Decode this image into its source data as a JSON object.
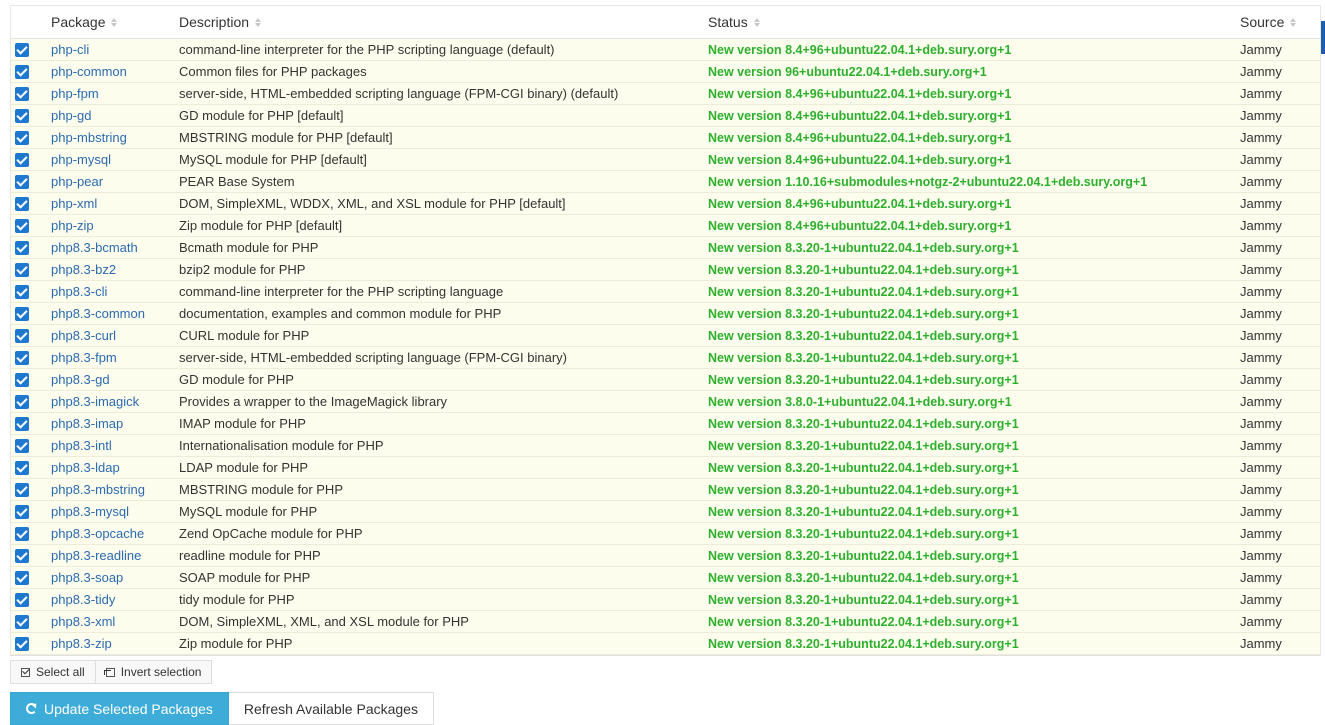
{
  "table": {
    "headers": {
      "package": "Package",
      "description": "Description",
      "status": "Status",
      "source": "Source"
    },
    "rows": [
      {
        "package": "php-cli",
        "description": "command-line interpreter for the PHP scripting language (default)",
        "status": "New version 8.4+96+ubuntu22.04.1+deb.sury.org+1",
        "source": "Jammy"
      },
      {
        "package": "php-common",
        "description": "Common files for PHP packages",
        "status": "New version 96+ubuntu22.04.1+deb.sury.org+1",
        "source": "Jammy"
      },
      {
        "package": "php-fpm",
        "description": "server-side, HTML-embedded scripting language (FPM-CGI binary) (default)",
        "status": "New version 8.4+96+ubuntu22.04.1+deb.sury.org+1",
        "source": "Jammy"
      },
      {
        "package": "php-gd",
        "description": "GD module for PHP [default]",
        "status": "New version 8.4+96+ubuntu22.04.1+deb.sury.org+1",
        "source": "Jammy"
      },
      {
        "package": "php-mbstring",
        "description": "MBSTRING module for PHP [default]",
        "status": "New version 8.4+96+ubuntu22.04.1+deb.sury.org+1",
        "source": "Jammy"
      },
      {
        "package": "php-mysql",
        "description": "MySQL module for PHP [default]",
        "status": "New version 8.4+96+ubuntu22.04.1+deb.sury.org+1",
        "source": "Jammy"
      },
      {
        "package": "php-pear",
        "description": "PEAR Base System",
        "status": "New version 1.10.16+submodules+notgz-2+ubuntu22.04.1+deb.sury.org+1",
        "source": "Jammy"
      },
      {
        "package": "php-xml",
        "description": "DOM, SimpleXML, WDDX, XML, and XSL module for PHP [default]",
        "status": "New version 8.4+96+ubuntu22.04.1+deb.sury.org+1",
        "source": "Jammy"
      },
      {
        "package": "php-zip",
        "description": "Zip module for PHP [default]",
        "status": "New version 8.4+96+ubuntu22.04.1+deb.sury.org+1",
        "source": "Jammy"
      },
      {
        "package": "php8.3-bcmath",
        "description": "Bcmath module for PHP",
        "status": "New version 8.3.20-1+ubuntu22.04.1+deb.sury.org+1",
        "source": "Jammy"
      },
      {
        "package": "php8.3-bz2",
        "description": "bzip2 module for PHP",
        "status": "New version 8.3.20-1+ubuntu22.04.1+deb.sury.org+1",
        "source": "Jammy"
      },
      {
        "package": "php8.3-cli",
        "description": "command-line interpreter for the PHP scripting language",
        "status": "New version 8.3.20-1+ubuntu22.04.1+deb.sury.org+1",
        "source": "Jammy"
      },
      {
        "package": "php8.3-common",
        "description": "documentation, examples and common module for PHP",
        "status": "New version 8.3.20-1+ubuntu22.04.1+deb.sury.org+1",
        "source": "Jammy"
      },
      {
        "package": "php8.3-curl",
        "description": "CURL module for PHP",
        "status": "New version 8.3.20-1+ubuntu22.04.1+deb.sury.org+1",
        "source": "Jammy"
      },
      {
        "package": "php8.3-fpm",
        "description": "server-side, HTML-embedded scripting language (FPM-CGI binary)",
        "status": "New version 8.3.20-1+ubuntu22.04.1+deb.sury.org+1",
        "source": "Jammy"
      },
      {
        "package": "php8.3-gd",
        "description": "GD module for PHP",
        "status": "New version 8.3.20-1+ubuntu22.04.1+deb.sury.org+1",
        "source": "Jammy"
      },
      {
        "package": "php8.3-imagick",
        "description": "Provides a wrapper to the ImageMagick library",
        "status": "New version 3.8.0-1+ubuntu22.04.1+deb.sury.org+1",
        "source": "Jammy"
      },
      {
        "package": "php8.3-imap",
        "description": "IMAP module for PHP",
        "status": "New version 8.3.20-1+ubuntu22.04.1+deb.sury.org+1",
        "source": "Jammy"
      },
      {
        "package": "php8.3-intl",
        "description": "Internationalisation module for PHP",
        "status": "New version 8.3.20-1+ubuntu22.04.1+deb.sury.org+1",
        "source": "Jammy"
      },
      {
        "package": "php8.3-ldap",
        "description": "LDAP module for PHP",
        "status": "New version 8.3.20-1+ubuntu22.04.1+deb.sury.org+1",
        "source": "Jammy"
      },
      {
        "package": "php8.3-mbstring",
        "description": "MBSTRING module for PHP",
        "status": "New version 8.3.20-1+ubuntu22.04.1+deb.sury.org+1",
        "source": "Jammy"
      },
      {
        "package": "php8.3-mysql",
        "description": "MySQL module for PHP",
        "status": "New version 8.3.20-1+ubuntu22.04.1+deb.sury.org+1",
        "source": "Jammy"
      },
      {
        "package": "php8.3-opcache",
        "description": "Zend OpCache module for PHP",
        "status": "New version 8.3.20-1+ubuntu22.04.1+deb.sury.org+1",
        "source": "Jammy"
      },
      {
        "package": "php8.3-readline",
        "description": "readline module for PHP",
        "status": "New version 8.3.20-1+ubuntu22.04.1+deb.sury.org+1",
        "source": "Jammy"
      },
      {
        "package": "php8.3-soap",
        "description": "SOAP module for PHP",
        "status": "New version 8.3.20-1+ubuntu22.04.1+deb.sury.org+1",
        "source": "Jammy"
      },
      {
        "package": "php8.3-tidy",
        "description": "tidy module for PHP",
        "status": "New version 8.3.20-1+ubuntu22.04.1+deb.sury.org+1",
        "source": "Jammy"
      },
      {
        "package": "php8.3-xml",
        "description": "DOM, SimpleXML, XML, and XSL module for PHP",
        "status": "New version 8.3.20-1+ubuntu22.04.1+deb.sury.org+1",
        "source": "Jammy"
      },
      {
        "package": "php8.3-zip",
        "description": "Zip module for PHP",
        "status": "New version 8.3.20-1+ubuntu22.04.1+deb.sury.org+1",
        "source": "Jammy"
      }
    ]
  },
  "selection": {
    "select_all_label": "Select all",
    "invert_label": "Invert selection"
  },
  "actions": {
    "update_label": "Update Selected Packages",
    "refresh_label": "Refresh Available Packages"
  },
  "icons": {
    "checkbox": "checkbox-checked-icon",
    "select_all": "check-square-icon",
    "invert": "invert-square-icon",
    "update": "refresh-icon",
    "sort": "sort-icon"
  },
  "colors": {
    "status": "#2db02d",
    "link": "#2a6bb0",
    "primary_button": "#3dacd9",
    "checkbox": "#1e78d0",
    "row_bg": "#fdfdee"
  }
}
